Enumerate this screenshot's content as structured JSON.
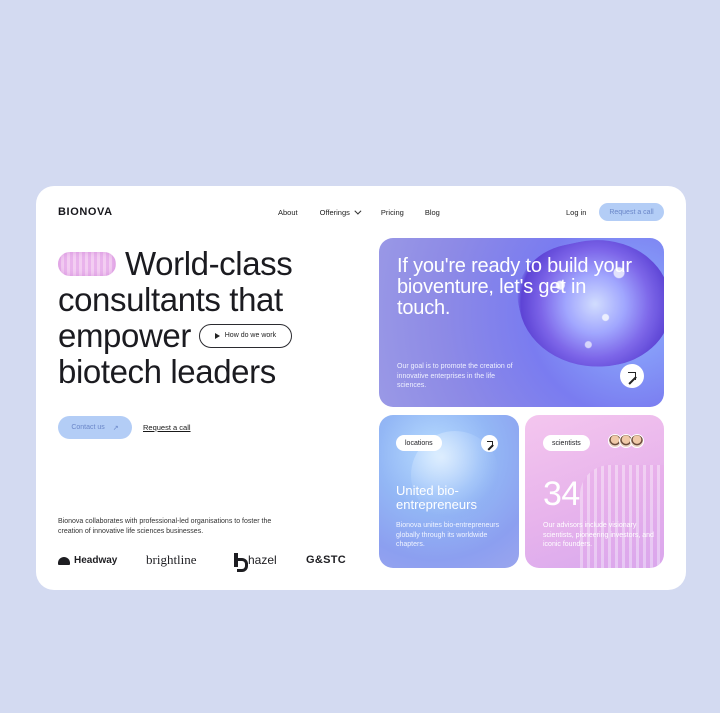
{
  "header": {
    "logo": "BIONOVA",
    "nav": [
      {
        "label": "About"
      },
      {
        "label": "Offerings"
      },
      {
        "label": "Pricing"
      },
      {
        "label": "Blog"
      }
    ],
    "login": "Log in",
    "request_call": "Request a call"
  },
  "hero": {
    "line1": "World-class",
    "line2": "consultants that",
    "line3": "empower",
    "line4": "biotech leaders",
    "how_button": "How do we work",
    "contact_button": "Contact us",
    "request_link": "Request a call",
    "description": "Bionova collaborates with professional-led organisations to foster the creation of innovative life sciences businesses."
  },
  "brands": [
    "Headway",
    "brightline",
    "hazel",
    "G&STC"
  ],
  "panel_main": {
    "headline": "If you're ready to build your bioventure, let's get in touch.",
    "sub": "Our goal is to promote the creation of innovative enterprises in the life sciences."
  },
  "panel_locations": {
    "tag": "locations",
    "headline": "United bio-entrepreneurs",
    "sub": "Bionova unites bio-entrepreneurs globally through its worldwide chapters."
  },
  "panel_scientists": {
    "tag": "scientists",
    "number": "34",
    "sub": "Our advisors include visionary scientists, pioneering investors, and iconic founders."
  },
  "colors": {
    "background": "#d3daf1",
    "accent_button": "#b3cdf6",
    "panel_purple": "#7a7cf0",
    "panel_blue": "#93b7f5",
    "panel_pink": "#e7b3ec"
  }
}
